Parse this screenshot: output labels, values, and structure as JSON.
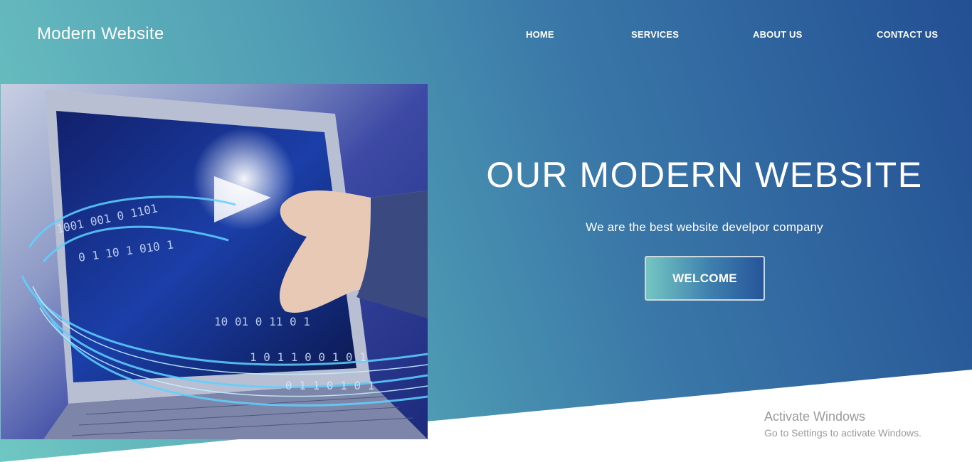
{
  "header": {
    "logo": "Modern Website",
    "nav": [
      "HOME",
      "SERVICES",
      "ABOUT US",
      "CONTACT US"
    ]
  },
  "hero": {
    "title": "OUR MODERN WEBSITE",
    "subtitle": "We are the best website develpor company",
    "button_label": "WELCOME",
    "image_alt": "laptop-digital-data-image"
  },
  "os_overlay": {
    "line1": "Activate Windows",
    "line2": "Go to Settings to activate Windows."
  },
  "colors": {
    "gradient_start": "#6fc7c2",
    "gradient_end": "#234f93",
    "text": "#ffffff"
  }
}
